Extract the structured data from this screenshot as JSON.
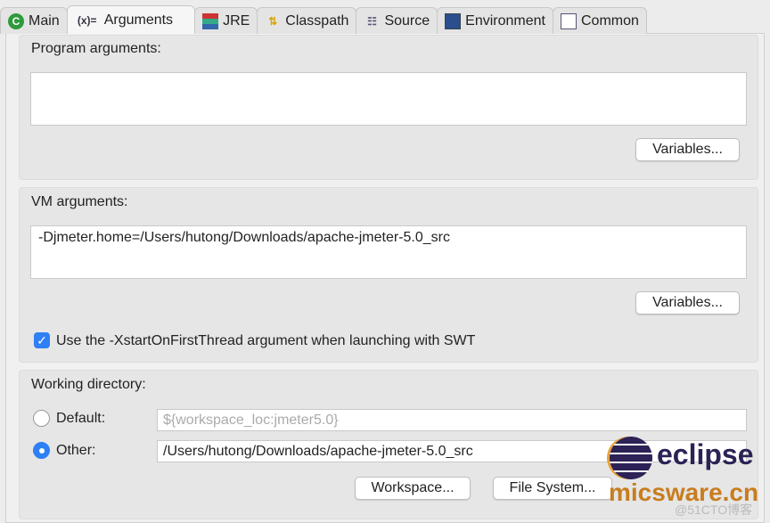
{
  "tabs": [
    {
      "label": "Main",
      "icon": "main-c-icon"
    },
    {
      "label": "Arguments",
      "icon": "arguments-x-icon"
    },
    {
      "label": "JRE",
      "icon": "jre-books-icon"
    },
    {
      "label": "Classpath",
      "icon": "classpath-icon"
    },
    {
      "label": "Source",
      "icon": "source-icon"
    },
    {
      "label": "Environment",
      "icon": "environment-icon"
    },
    {
      "label": "Common",
      "icon": "common-icon"
    }
  ],
  "program": {
    "label": "Program arguments:",
    "value": "",
    "variables": "Variables..."
  },
  "vm": {
    "label": "VM arguments:",
    "value": "-Djmeter.home=/Users/hutong/Downloads/apache-jmeter-5.0_src",
    "variables": "Variables...",
    "checkbox_label": "Use the -XstartOnFirstThread argument when launching with SWT",
    "checked": true
  },
  "workdir": {
    "label": "Working directory:",
    "default_label": "Default:",
    "default_value": "${workspace_loc:jmeter5.0}",
    "other_label": "Other:",
    "other_value": "/Users/hutong/Downloads/apache-jmeter-5.0_src",
    "selected": "Other",
    "workspace": "Workspace...",
    "filesystem": "File System..."
  },
  "watermark": {
    "logo": "eclipse",
    "site": "micsware.cn",
    "credit": "@51CTO博客"
  }
}
